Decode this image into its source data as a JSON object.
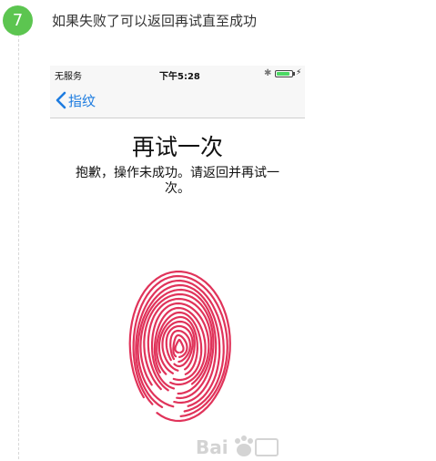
{
  "step": {
    "number": "7",
    "text": "如果失败了可以返回再试直至成功"
  },
  "phone": {
    "status_bar": {
      "carrier": "无服务",
      "time": "下午5:28",
      "battery_level": 0.9
    },
    "nav": {
      "back_label": "指纹"
    },
    "title": "再试一次",
    "message": "抱歉，操作未成功。请返回并再试一次。"
  },
  "colors": {
    "accent": "#5cc550",
    "link": "#1d7ce0",
    "fingerprint": "#e0335a"
  },
  "icons": [
    "chevron-left-icon",
    "bluetooth-icon",
    "battery-icon",
    "charging-icon",
    "fingerprint-icon"
  ]
}
